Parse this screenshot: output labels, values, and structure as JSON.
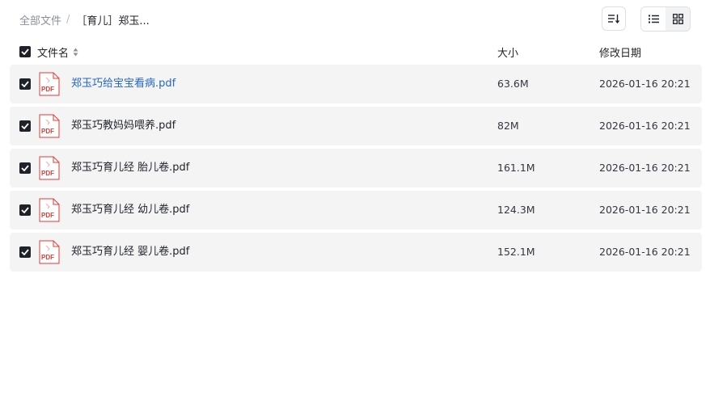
{
  "breadcrumb": {
    "root": "全部文件",
    "separator": "/",
    "current": "［育儿］郑玉..."
  },
  "toolbar": {
    "sort_icon": "sort-list-icon",
    "list_view_icon": "list-view-icon",
    "grid_view_icon": "grid-view-icon",
    "active_view": "list"
  },
  "columns": {
    "name": "文件名",
    "size": "大小",
    "modified": "修改日期"
  },
  "files": [
    {
      "name": "郑玉巧给宝宝看病.pdf",
      "size": "63.6M",
      "modified": "2026-01-16 20:21",
      "checked": true,
      "highlighted": true
    },
    {
      "name": "郑玉巧教妈妈喂养.pdf",
      "size": "82M",
      "modified": "2026-01-16 20:21",
      "checked": true
    },
    {
      "name": "郑玉巧育儿经 胎儿卷.pdf",
      "size": "161.1M",
      "modified": "2026-01-16 20:21",
      "checked": true
    },
    {
      "name": "郑玉巧育儿经 幼儿卷.pdf",
      "size": "124.3M",
      "modified": "2026-01-16 20:21",
      "checked": true
    },
    {
      "name": "郑玉巧育儿经 婴儿卷.pdf",
      "size": "152.1M",
      "modified": "2026-01-16 20:21",
      "checked": true
    }
  ],
  "colors": {
    "link": "#2567c9",
    "row_background": "#f4f4f5",
    "pdf_red": "#e53935",
    "checkbox": "#1f2329"
  }
}
